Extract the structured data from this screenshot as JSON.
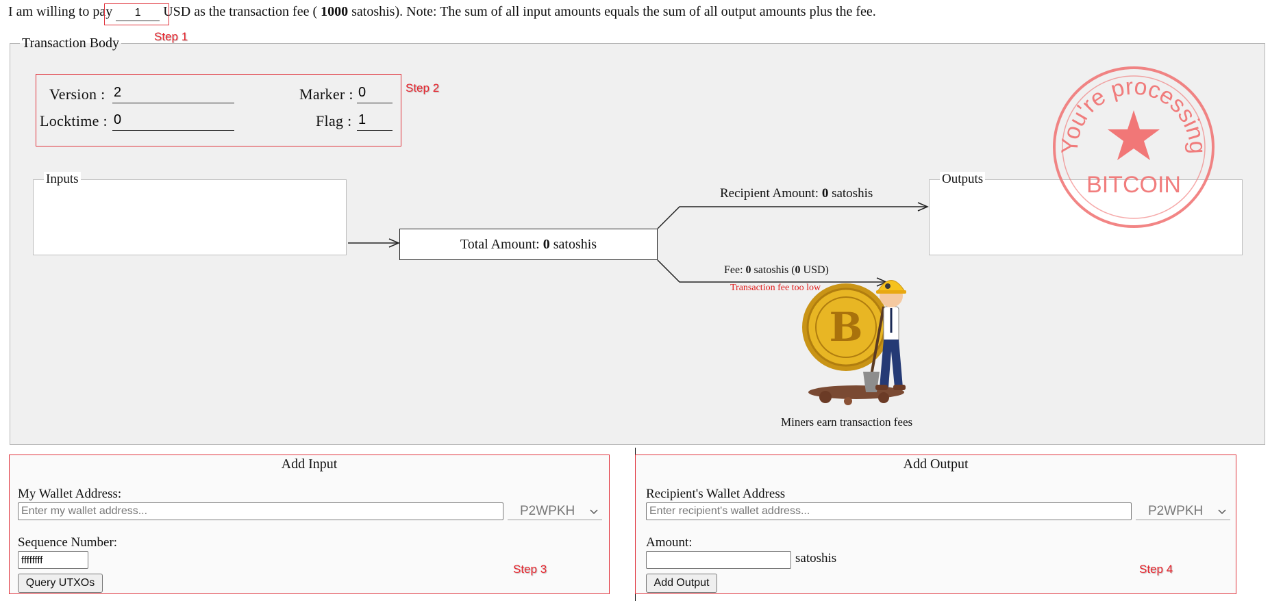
{
  "fee_line": {
    "prefix": "I am willing to pay",
    "usd_value": "1",
    "middle": "USD as the transaction fee (",
    "satoshis": "1000",
    "suffix": "satoshis). Note: The sum of all input amounts equals the sum of all output amounts plus the fee."
  },
  "steps": {
    "step1": "Step 1",
    "step2": "Step 2",
    "step3": "Step 3",
    "step4": "Step 4"
  },
  "tx_body": {
    "legend": "Transaction Body",
    "version_label": "Version :",
    "version_value": "2",
    "locktime_label": "Locktime :",
    "locktime_value": "0",
    "marker_label": "Marker :",
    "marker_value": "0",
    "flag_label": "Flag :",
    "flag_value": "1",
    "inputs_legend": "Inputs",
    "outputs_legend": "Outputs",
    "total_prefix": "Total Amount:",
    "total_value": "0",
    "total_suffix": "satoshis",
    "recipient_prefix": "Recipient Amount:",
    "recipient_value": "0",
    "recipient_suffix": "satoshis",
    "fee_prefix": "Fee:",
    "fee_sats": "0",
    "fee_mid": "satoshis (",
    "fee_usd": "0",
    "fee_suffix": "USD)",
    "fee_warning": "Transaction fee too low",
    "miner_caption": "Miners earn transaction fees"
  },
  "stamp": {
    "arc_text": "You're processing",
    "bottom_text": "BITCOIN",
    "color": "#f07070"
  },
  "add_input": {
    "title": "Add Input",
    "wallet_label": "My Wallet Address:",
    "wallet_placeholder": "Enter my wallet address...",
    "address_type": "P2WPKH",
    "sequence_label": "Sequence Number:",
    "sequence_value": "ffffffff",
    "query_button": "Query UTXOs"
  },
  "add_output": {
    "title": "Add Output",
    "wallet_label": "Recipient's Wallet Address",
    "wallet_placeholder": "Enter recipient's wallet address...",
    "address_type": "P2WPKH",
    "amount_label": "Amount:",
    "amount_value": "",
    "amount_unit": "satoshis",
    "add_button": "Add Output"
  },
  "colors": {
    "accent_red": "#e0313a",
    "body_bg": "#f0f0f0",
    "warning": "#e01b1b"
  }
}
